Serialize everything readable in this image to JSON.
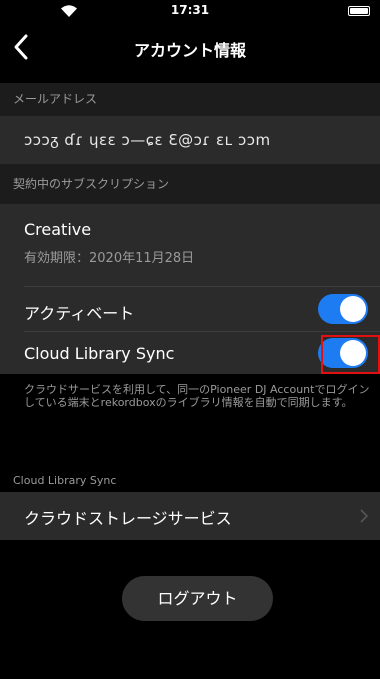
{
  "status_bar": {
    "time": "17:31"
  },
  "nav": {
    "title": "アカウント情報"
  },
  "email_section": {
    "header": "メールアドレス",
    "value": "ɔɔɔᵹ ɗɾ ɥɛɛ ɔ—ɕɛ Ɛ@ɔɾ ɛʟ ɔɔm"
  },
  "subscription_section": {
    "header": "契約中のサブスクリプション",
    "plan": "Creative",
    "expiry": "有効期限：2020年11月28日",
    "activate_label": "アクティベート",
    "sync_label": "Cloud Library Sync",
    "description": "クラウドサービスを利用して、同一のPioneer DJ Accountでログインしている端末とrekordboxのライブラリ情報を自動で同期します。"
  },
  "cloud_section": {
    "header": "Cloud Library Sync",
    "storage_label": "クラウドストレージサービス"
  },
  "logout": {
    "label": "ログアウト"
  },
  "colors": {
    "toggle_on": "#1e7cf2",
    "highlight": "#e21010",
    "cell_bg": "#2b2b2b",
    "header_bg": "#1c1c1c"
  },
  "toggles": {
    "activate": true,
    "cloud_sync": true
  }
}
